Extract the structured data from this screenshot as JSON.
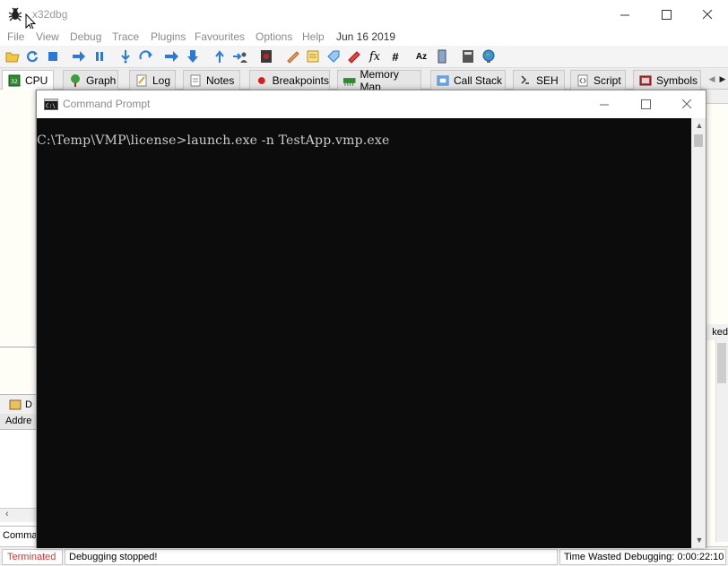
{
  "app": {
    "title": "x32dbg",
    "menu": [
      "File",
      "View",
      "Debug",
      "Trace",
      "Plugins",
      "Favourites",
      "Options",
      "Help",
      "Jun 16 2019"
    ]
  },
  "tabs": [
    {
      "label": "CPU",
      "icon": "cpu-icon",
      "active": true
    },
    {
      "label": "Graph",
      "icon": "graph-icon"
    },
    {
      "label": "Log",
      "icon": "log-icon"
    },
    {
      "label": "Notes",
      "icon": "notes-icon"
    },
    {
      "label": "Breakpoints",
      "icon": "breakpoint-icon"
    },
    {
      "label": "Memory Map",
      "icon": "memory-icon"
    },
    {
      "label": "Call Stack",
      "icon": "callstack-icon"
    },
    {
      "label": "SEH",
      "icon": "seh-icon"
    },
    {
      "label": "Script",
      "icon": "script-icon"
    },
    {
      "label": "Symbols",
      "icon": "symbols-icon"
    }
  ],
  "background": {
    "lower_tab": "D",
    "addr_header": "Addre",
    "cmd_label": "Comman",
    "right_label": "ked"
  },
  "cmd_window": {
    "title": "Command Prompt",
    "line": "C:\\Temp\\VMP\\license>launch.exe -n TestApp.vmp.exe"
  },
  "status": {
    "state": "Terminated",
    "message": "Debugging stopped!",
    "time": "Time Wasted Debugging: 0:00:22:10"
  },
  "colors": {
    "terminated": "#e03030",
    "console_bg": "#0c0c0c",
    "console_fg": "#cccccc"
  }
}
